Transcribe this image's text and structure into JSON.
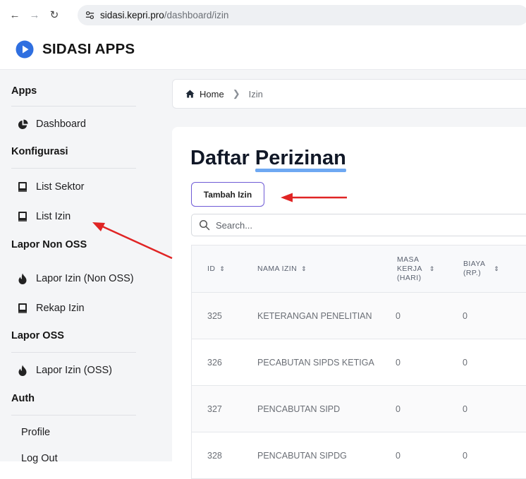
{
  "browser": {
    "url_domain": "sidasi.kepri.pro",
    "url_path": "/dashboard/izin"
  },
  "app": {
    "title": "SIDASI APPS",
    "accent_color": "#2f6fe0"
  },
  "sidebar": {
    "sections": [
      {
        "title": "Apps",
        "items": [
          {
            "label": "Dashboard",
            "icon": "pie-chart-icon"
          }
        ]
      },
      {
        "title": "Konfigurasi",
        "items": [
          {
            "label": "List Sektor",
            "icon": "book-icon"
          },
          {
            "label": "List Izin",
            "icon": "book-icon"
          }
        ]
      },
      {
        "title": "Lapor Non OSS",
        "items": [
          {
            "label": "Lapor Izin (Non OSS)",
            "icon": "flame-icon"
          },
          {
            "label": "Rekap Izin",
            "icon": "book-icon"
          }
        ]
      },
      {
        "title": "Lapor OSS",
        "items": [
          {
            "label": "Lapor Izin (OSS)",
            "icon": "flame-icon"
          }
        ]
      },
      {
        "title": "Auth",
        "items": [
          {
            "label": "Profile"
          },
          {
            "label": "Log Out"
          }
        ]
      }
    ]
  },
  "breadcrumb": {
    "home": "Home",
    "current": "Izin"
  },
  "page": {
    "title_part1": "Daftar",
    "title_part2": "Perizinan",
    "add_button": "Tambah Izin",
    "search_placeholder": "Search..."
  },
  "table": {
    "headers": {
      "id": "ID",
      "name": "NAMA IZIN",
      "masa_line1": "MASA",
      "masa_line2": "KERJA",
      "masa_line3": "(HARI)",
      "biaya_line1": "BIAYA",
      "biaya_line2": "(RP.)"
    },
    "rows": [
      {
        "id": "325",
        "name": "KETERANGAN PENELITIAN",
        "masa": "0",
        "biaya": "0"
      },
      {
        "id": "326",
        "name": "PECABUTAN SIPDS KETIGA",
        "masa": "0",
        "biaya": "0"
      },
      {
        "id": "327",
        "name": "PENCABUTAN SIPD",
        "masa": "0",
        "biaya": "0"
      },
      {
        "id": "328",
        "name": "PENCABUTAN SIPDG",
        "masa": "0",
        "biaya": "0"
      }
    ]
  },
  "annotation": {
    "arrow_color": "#e02424"
  }
}
